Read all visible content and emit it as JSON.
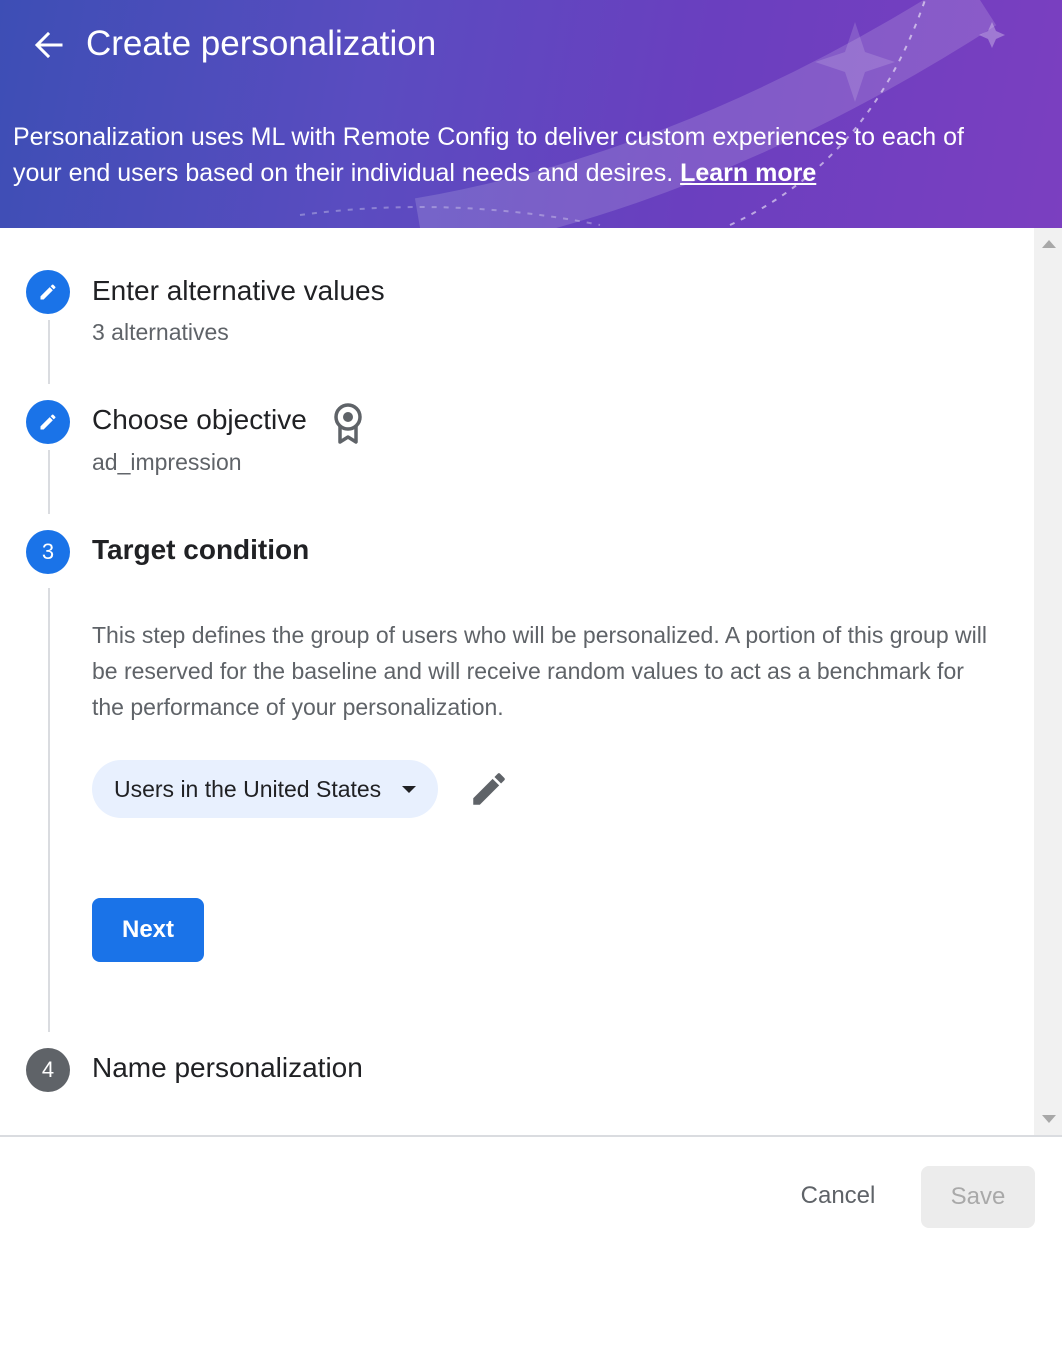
{
  "header": {
    "title": "Create personalization",
    "description": "Personalization uses ML with Remote Config to deliver custom experiences to each of your end users based on their individual needs and desires.",
    "learn_more_label": "Learn more"
  },
  "steps": [
    {
      "number": "1",
      "title": "Enter alternative values",
      "subtitle": "3 alternatives",
      "state": "completed",
      "icon": "pencil-icon"
    },
    {
      "number": "2",
      "title": "Choose objective",
      "subtitle": "ad_impression",
      "state": "completed",
      "icon": "pencil-icon",
      "badge_icon": "award-badge-icon"
    },
    {
      "number": "3",
      "title": "Target condition",
      "state": "active",
      "description": "This step defines the group of users who will be personalized. A portion of this group will be reserved for the baseline and will receive random values to act as a benchmark for the performance of your personalization.",
      "condition_select": "Users in the United States",
      "next_label": "Next"
    },
    {
      "number": "4",
      "title": "Name personalization",
      "state": "pending"
    }
  ],
  "footer": {
    "cancel_label": "Cancel",
    "save_label": "Save"
  },
  "colors": {
    "primary": "#1a73e8",
    "header_gradient_start": "#3d4eb5",
    "header_gradient_end": "#7b3fc0",
    "chip_bg": "#e8f0fe",
    "pending_step": "#5f6368"
  }
}
